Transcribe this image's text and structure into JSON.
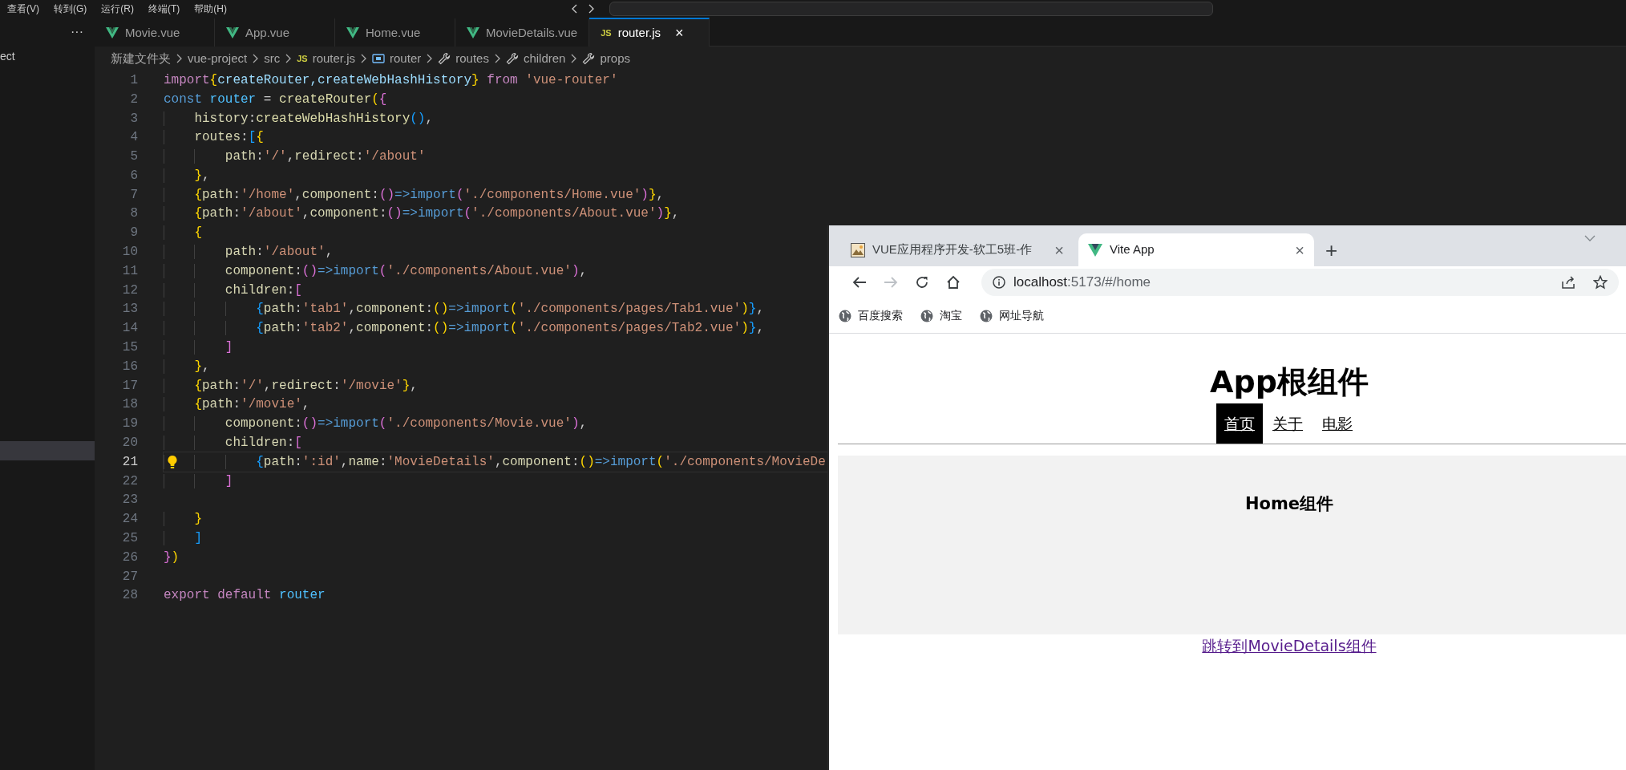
{
  "menu": [
    "查看(V)",
    "转到(G)",
    "运行(R)",
    "终端(T)",
    "帮助(H)"
  ],
  "explorer": {
    "more": "···",
    "rows": [
      {
        "label": "ect",
        "selected": false
      },
      {
        "selected": true
      }
    ]
  },
  "editor_tabs": [
    {
      "label": "Movie.vue",
      "kind": "vue",
      "selected": false
    },
    {
      "label": "App.vue",
      "kind": "vue",
      "selected": false
    },
    {
      "label": "Home.vue",
      "kind": "vue",
      "selected": false
    },
    {
      "label": "MovieDetails.vue",
      "kind": "vue",
      "selected": false
    },
    {
      "label": "router.js",
      "kind": "js",
      "icon_text": "JS",
      "selected": true,
      "close": "×"
    }
  ],
  "breadcrumb": [
    {
      "label": "新建文件夹"
    },
    {
      "label": "vue-project"
    },
    {
      "label": "src"
    },
    {
      "label": "router.js",
      "kind": "js",
      "icon_text": "JS"
    },
    {
      "label": "router",
      "kind": "variable"
    },
    {
      "label": "routes",
      "kind": "property"
    },
    {
      "label": "children",
      "kind": "property"
    },
    {
      "label": "props",
      "kind": "property"
    }
  ],
  "code_lines": [
    {
      "number": "1",
      "current": false,
      "tokens": [
        {
          "text": "import",
          "kind": "kw"
        },
        {
          "text": "{",
          "kind": "b1"
        },
        {
          "text": "createRouter,createWebHashHistory",
          "kind": "var"
        },
        {
          "text": "}",
          "kind": "b1"
        },
        {
          "text": " from ",
          "kind": "kw"
        },
        {
          "text": "'vue-router'",
          "kind": "str"
        }
      ]
    },
    {
      "number": "2",
      "current": false,
      "tokens": [
        {
          "text": "const ",
          "kind": "kw2"
        },
        {
          "text": "router",
          "kind": "cst"
        },
        {
          "text": " = ",
          "kind": "pun"
        },
        {
          "text": "createRouter",
          "kind": "fn"
        },
        {
          "text": "(",
          "kind": "b1"
        },
        {
          "text": "{",
          "kind": "b2"
        }
      ]
    },
    {
      "number": "3",
      "current": false,
      "tokens": [
        {
          "text": "    history",
          "kind": "key"
        },
        {
          "text": ":",
          "kind": "pun"
        },
        {
          "text": "createWebHashHistory",
          "kind": "fn"
        },
        {
          "text": "()",
          "kind": "b3"
        },
        {
          "text": ",",
          "kind": "pun"
        }
      ]
    },
    {
      "number": "4",
      "current": false,
      "tokens": [
        {
          "text": "    routes",
          "kind": "key"
        },
        {
          "text": ":",
          "kind": "pun"
        },
        {
          "text": "[",
          "kind": "b3"
        },
        {
          "text": "{",
          "kind": "b1"
        }
      ]
    },
    {
      "number": "5",
      "current": false,
      "tokens": [
        {
          "text": "        path",
          "kind": "key"
        },
        {
          "text": ":",
          "kind": "pun"
        },
        {
          "text": "'/'",
          "kind": "str"
        },
        {
          "text": ",",
          "kind": "pun"
        },
        {
          "text": "redirect",
          "kind": "key"
        },
        {
          "text": ":",
          "kind": "pun"
        },
        {
          "text": "'/about'",
          "kind": "str"
        }
      ]
    },
    {
      "number": "6",
      "current": false,
      "tokens": [
        {
          "text": "    }",
          "kind": "b1"
        },
        {
          "text": ",",
          "kind": "pun"
        }
      ]
    },
    {
      "number": "7",
      "current": false,
      "tokens": [
        {
          "text": "    {",
          "kind": "b1"
        },
        {
          "text": "path",
          "kind": "key"
        },
        {
          "text": ":",
          "kind": "pun"
        },
        {
          "text": "'/home'",
          "kind": "str"
        },
        {
          "text": ",",
          "kind": "pun"
        },
        {
          "text": "component",
          "kind": "key"
        },
        {
          "text": ":",
          "kind": "pun"
        },
        {
          "text": "()",
          "kind": "b2"
        },
        {
          "text": "=>import",
          "kind": "kw2"
        },
        {
          "text": "(",
          "kind": "b2"
        },
        {
          "text": "'./components/Home.vue'",
          "kind": "str"
        },
        {
          "text": ")",
          "kind": "b2"
        },
        {
          "text": "}",
          "kind": "b1"
        },
        {
          "text": ",",
          "kind": "pun"
        }
      ]
    },
    {
      "number": "8",
      "current": false,
      "tokens": [
        {
          "text": "    {",
          "kind": "b1"
        },
        {
          "text": "path",
          "kind": "key"
        },
        {
          "text": ":",
          "kind": "pun"
        },
        {
          "text": "'/about'",
          "kind": "str"
        },
        {
          "text": ",",
          "kind": "pun"
        },
        {
          "text": "component",
          "kind": "key"
        },
        {
          "text": ":",
          "kind": "pun"
        },
        {
          "text": "()",
          "kind": "b2"
        },
        {
          "text": "=>import",
          "kind": "kw2"
        },
        {
          "text": "(",
          "kind": "b2"
        },
        {
          "text": "'./components/About.vue'",
          "kind": "str"
        },
        {
          "text": ")",
          "kind": "b2"
        },
        {
          "text": "}",
          "kind": "b1"
        },
        {
          "text": ",",
          "kind": "pun"
        }
      ]
    },
    {
      "number": "9",
      "current": false,
      "tokens": [
        {
          "text": "    {",
          "kind": "b1"
        }
      ]
    },
    {
      "number": "10",
      "current": false,
      "tokens": [
        {
          "text": "        path",
          "kind": "key"
        },
        {
          "text": ":",
          "kind": "pun"
        },
        {
          "text": "'/about'",
          "kind": "str"
        },
        {
          "text": ",",
          "kind": "pun"
        }
      ]
    },
    {
      "number": "11",
      "current": false,
      "tokens": [
        {
          "text": "        component",
          "kind": "key"
        },
        {
          "text": ":",
          "kind": "pun"
        },
        {
          "text": "()",
          "kind": "b2"
        },
        {
          "text": "=>import",
          "kind": "kw2"
        },
        {
          "text": "(",
          "kind": "b2"
        },
        {
          "text": "'./components/About.vue'",
          "kind": "str"
        },
        {
          "text": ")",
          "kind": "b2"
        },
        {
          "text": ",",
          "kind": "pun"
        }
      ]
    },
    {
      "number": "12",
      "current": false,
      "tokens": [
        {
          "text": "        children",
          "kind": "key"
        },
        {
          "text": ":",
          "kind": "pun"
        },
        {
          "text": "[",
          "kind": "b2"
        }
      ]
    },
    {
      "number": "13",
      "current": false,
      "tokens": [
        {
          "text": "            {",
          "kind": "b3"
        },
        {
          "text": "path",
          "kind": "key"
        },
        {
          "text": ":",
          "kind": "pun"
        },
        {
          "text": "'tab1'",
          "kind": "str"
        },
        {
          "text": ",",
          "kind": "pun"
        },
        {
          "text": "component",
          "kind": "key"
        },
        {
          "text": ":",
          "kind": "pun"
        },
        {
          "text": "()",
          "kind": "b1"
        },
        {
          "text": "=>import",
          "kind": "kw2"
        },
        {
          "text": "(",
          "kind": "b1"
        },
        {
          "text": "'./components/pages/Tab1.vue'",
          "kind": "str"
        },
        {
          "text": ")",
          "kind": "b1"
        },
        {
          "text": "}",
          "kind": "b3"
        },
        {
          "text": ",",
          "kind": "pun"
        }
      ]
    },
    {
      "number": "14",
      "current": false,
      "tokens": [
        {
          "text": "            {",
          "kind": "b3"
        },
        {
          "text": "path",
          "kind": "key"
        },
        {
          "text": ":",
          "kind": "pun"
        },
        {
          "text": "'tab2'",
          "kind": "str"
        },
        {
          "text": ",",
          "kind": "pun"
        },
        {
          "text": "component",
          "kind": "key"
        },
        {
          "text": ":",
          "kind": "pun"
        },
        {
          "text": "()",
          "kind": "b1"
        },
        {
          "text": "=>import",
          "kind": "kw2"
        },
        {
          "text": "(",
          "kind": "b1"
        },
        {
          "text": "'./components/pages/Tab2.vue'",
          "kind": "str"
        },
        {
          "text": ")",
          "kind": "b1"
        },
        {
          "text": "}",
          "kind": "b3"
        },
        {
          "text": ",",
          "kind": "pun"
        }
      ]
    },
    {
      "number": "15",
      "current": false,
      "tokens": [
        {
          "text": "        ]",
          "kind": "b2"
        }
      ]
    },
    {
      "number": "16",
      "current": false,
      "tokens": [
        {
          "text": "    }",
          "kind": "b1"
        },
        {
          "text": ",",
          "kind": "pun"
        }
      ]
    },
    {
      "number": "17",
      "current": false,
      "tokens": [
        {
          "text": "    {",
          "kind": "b1"
        },
        {
          "text": "path",
          "kind": "key"
        },
        {
          "text": ":",
          "kind": "pun"
        },
        {
          "text": "'/'",
          "kind": "str"
        },
        {
          "text": ",",
          "kind": "pun"
        },
        {
          "text": "redirect",
          "kind": "key"
        },
        {
          "text": ":",
          "kind": "pun"
        },
        {
          "text": "'/movie'",
          "kind": "str"
        },
        {
          "text": "}",
          "kind": "b1"
        },
        {
          "text": ",",
          "kind": "pun"
        }
      ]
    },
    {
      "number": "18",
      "current": false,
      "tokens": [
        {
          "text": "    {",
          "kind": "b1"
        },
        {
          "text": "path",
          "kind": "key"
        },
        {
          "text": ":",
          "kind": "pun"
        },
        {
          "text": "'/movie'",
          "kind": "str"
        },
        {
          "text": ",",
          "kind": "pun"
        }
      ]
    },
    {
      "number": "19",
      "current": false,
      "tokens": [
        {
          "text": "        component",
          "kind": "key"
        },
        {
          "text": ":",
          "kind": "pun"
        },
        {
          "text": "()",
          "kind": "b2"
        },
        {
          "text": "=>import",
          "kind": "kw2"
        },
        {
          "text": "(",
          "kind": "b2"
        },
        {
          "text": "'./components/Movie.vue'",
          "kind": "str"
        },
        {
          "text": ")",
          "kind": "b2"
        },
        {
          "text": ",",
          "kind": "pun"
        }
      ]
    },
    {
      "number": "20",
      "current": false,
      "tokens": [
        {
          "text": "        children",
          "kind": "key"
        },
        {
          "text": ":",
          "kind": "pun"
        },
        {
          "text": "[",
          "kind": "b2"
        }
      ]
    },
    {
      "number": "21",
      "current": true,
      "tokens": [
        {
          "text": "            {",
          "kind": "b3"
        },
        {
          "text": "path",
          "kind": "key"
        },
        {
          "text": ":",
          "kind": "pun"
        },
        {
          "text": "':id'",
          "kind": "str"
        },
        {
          "text": ",",
          "kind": "pun"
        },
        {
          "text": "name",
          "kind": "key"
        },
        {
          "text": ":",
          "kind": "pun"
        },
        {
          "text": "'MovieDetails'",
          "kind": "str"
        },
        {
          "text": ",",
          "kind": "pun"
        },
        {
          "text": "component",
          "kind": "key"
        },
        {
          "text": ":",
          "kind": "pun"
        },
        {
          "text": "()",
          "kind": "b1"
        },
        {
          "text": "=>import",
          "kind": "kw2"
        },
        {
          "text": "(",
          "kind": "b1"
        },
        {
          "text": "'./components/MovieDe",
          "kind": "str"
        }
      ]
    },
    {
      "number": "22",
      "current": false,
      "tokens": [
        {
          "text": "        ]",
          "kind": "b2"
        }
      ]
    },
    {
      "number": "23",
      "current": false
    },
    {
      "number": "24",
      "current": false,
      "tokens": [
        {
          "text": "    }",
          "kind": "b1"
        }
      ]
    },
    {
      "number": "25",
      "current": false,
      "tokens": [
        {
          "text": "    ]",
          "kind": "b3"
        }
      ]
    },
    {
      "number": "26",
      "current": false,
      "tokens": [
        {
          "text": "}",
          "kind": "b2"
        },
        {
          "text": ")",
          "kind": "b1"
        }
      ]
    },
    {
      "number": "27",
      "current": false
    },
    {
      "number": "28",
      "current": false,
      "tokens": [
        {
          "text": "export default ",
          "kind": "kw"
        },
        {
          "text": "router",
          "kind": "cst"
        }
      ]
    }
  ],
  "browser": {
    "tabs": [
      {
        "title": "VUE应用程序开发-软工5班-作",
        "kind": "image",
        "selected": false,
        "close": "×"
      },
      {
        "title": "Vite App",
        "kind": "v",
        "selected": true,
        "close": "×"
      }
    ],
    "new_tab": "+",
    "toolbar_buttons": [
      {
        "kind": "back",
        "disabled": false
      },
      {
        "kind": "forward",
        "disabled": true
      },
      {
        "kind": "reload",
        "disabled": false
      },
      {
        "kind": "home",
        "disabled": false
      }
    ],
    "address": {
      "host": "localhost",
      "rest": ":5173/#/home"
    },
    "bookmarks": [
      "百度搜索",
      "淘宝",
      "网址导航"
    ],
    "page": {
      "title": "App根组件",
      "nav": [
        {
          "label": "首页",
          "selected": true
        },
        {
          "label": "关于",
          "selected": false
        },
        {
          "label": "电影",
          "selected": false
        }
      ],
      "panel_heading": "Home组件",
      "link": {
        "text": "跳转到MovieDetails组件",
        "visited": true
      }
    }
  }
}
